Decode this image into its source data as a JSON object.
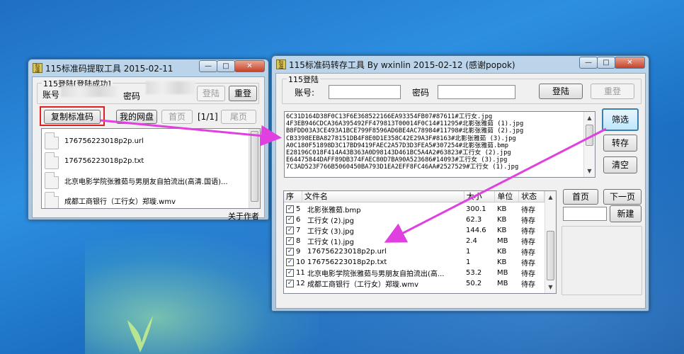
{
  "left_window": {
    "title": "115标准码提取工具 2015-02-11",
    "icon_text": "标准码",
    "group_title": "115登陆[登陆成功]",
    "account_label": "账号",
    "password_label": "密码",
    "login_button": "登陆",
    "relogin_button": "重登",
    "copy_button": "复制标准码",
    "my_drive_button": "我的网盘",
    "first_page_button": "首页",
    "page_indicator": "[1/1]",
    "last_page_button": "尾页",
    "about_link": "关于作者",
    "files": [
      {
        "name": "176756223018p2p.url"
      },
      {
        "name": "176756223018p2p.txt"
      },
      {
        "name": "北京电影学院张雅茹与男朋友自拍流出(高清.国语)..."
      },
      {
        "name": "成都工商银行（工行女）郑璇.wmv"
      }
    ]
  },
  "right_window": {
    "title": "115标准码转存工具 By wxinlin  2015-02-12 (感谢popok)",
    "icon_text": "标准码",
    "group_title": "115登陆",
    "account_label": "账号:",
    "password_label": "密码",
    "login_button": "登陆",
    "relogin_button": "重登",
    "filter_button": "筛选",
    "transfer_button": "转存",
    "clear_button": "清空",
    "first_page_button": "首页",
    "next_page_button": "下一页",
    "new_button": "新建",
    "code_lines": [
      "6C31D164D38F0C13F6E368522166EA93354FB07#87611#工行女.jpg",
      "4F3EB946CDCA36A395492FF479813T00014F0C14#11295#北影张雅茹 (1).jpg",
      "B8FDD03A3CE493A1BCE799F8596AD6BE4AC78984#11798#北影张雅茹 (2).jpg",
      "CB3398EEBA8278151DB4F8E0D1E358C42E29A3F#8163#北影张雅茹 (3).jpg",
      "A0C180F51898D3C17BD9419FAEC2A57D3D3FEA5#307254#北影张雅茹.bmp",
      "E28196C018F414A43B363A0D98143D461BC5A4A2#63823#工行女 (2).jpg",
      "E64475844DAFF89DB374FAEC80D7BA90A523686#14093#工行女 (3).jpg",
      "7C3AD523F766B5060450BA793D1EA2EFF8FC46AA#2527529#工行女 (1).jpg"
    ],
    "table_headers": [
      "序",
      "文件名",
      "大小",
      "单位",
      "状态"
    ],
    "table_rows": [
      {
        "index": "5",
        "name": "北影张雅茹.bmp",
        "size": "300.1",
        "unit": "KB",
        "status": "待存"
      },
      {
        "index": "6",
        "name": "工行女 (2).jpg",
        "size": "62.3",
        "unit": "KB",
        "status": "待存"
      },
      {
        "index": "7",
        "name": "工行女 (3).jpg",
        "size": "144.6",
        "unit": "KB",
        "status": "待存"
      },
      {
        "index": "8",
        "name": "工行女 (1).jpg",
        "size": "2.4",
        "unit": "MB",
        "status": "待存"
      },
      {
        "index": "9",
        "name": "176756223018p2p.url",
        "size": "1",
        "unit": "KB",
        "status": "待存"
      },
      {
        "index": "10",
        "name": "176756223018p2p.txt",
        "size": "1",
        "unit": "KB",
        "status": "待存"
      },
      {
        "index": "11",
        "name": "北京电影学院张雅茹与男朋友自拍流出(高...",
        "size": "53.2",
        "unit": "MB",
        "status": "待存"
      },
      {
        "index": "12",
        "name": "成都工商银行（工行女）郑璇.wmv",
        "size": "50.2",
        "unit": "MB",
        "status": "待存"
      }
    ]
  },
  "colors": {
    "annotation_arrow": "#e040e0",
    "highlight_box": "#e02020"
  }
}
